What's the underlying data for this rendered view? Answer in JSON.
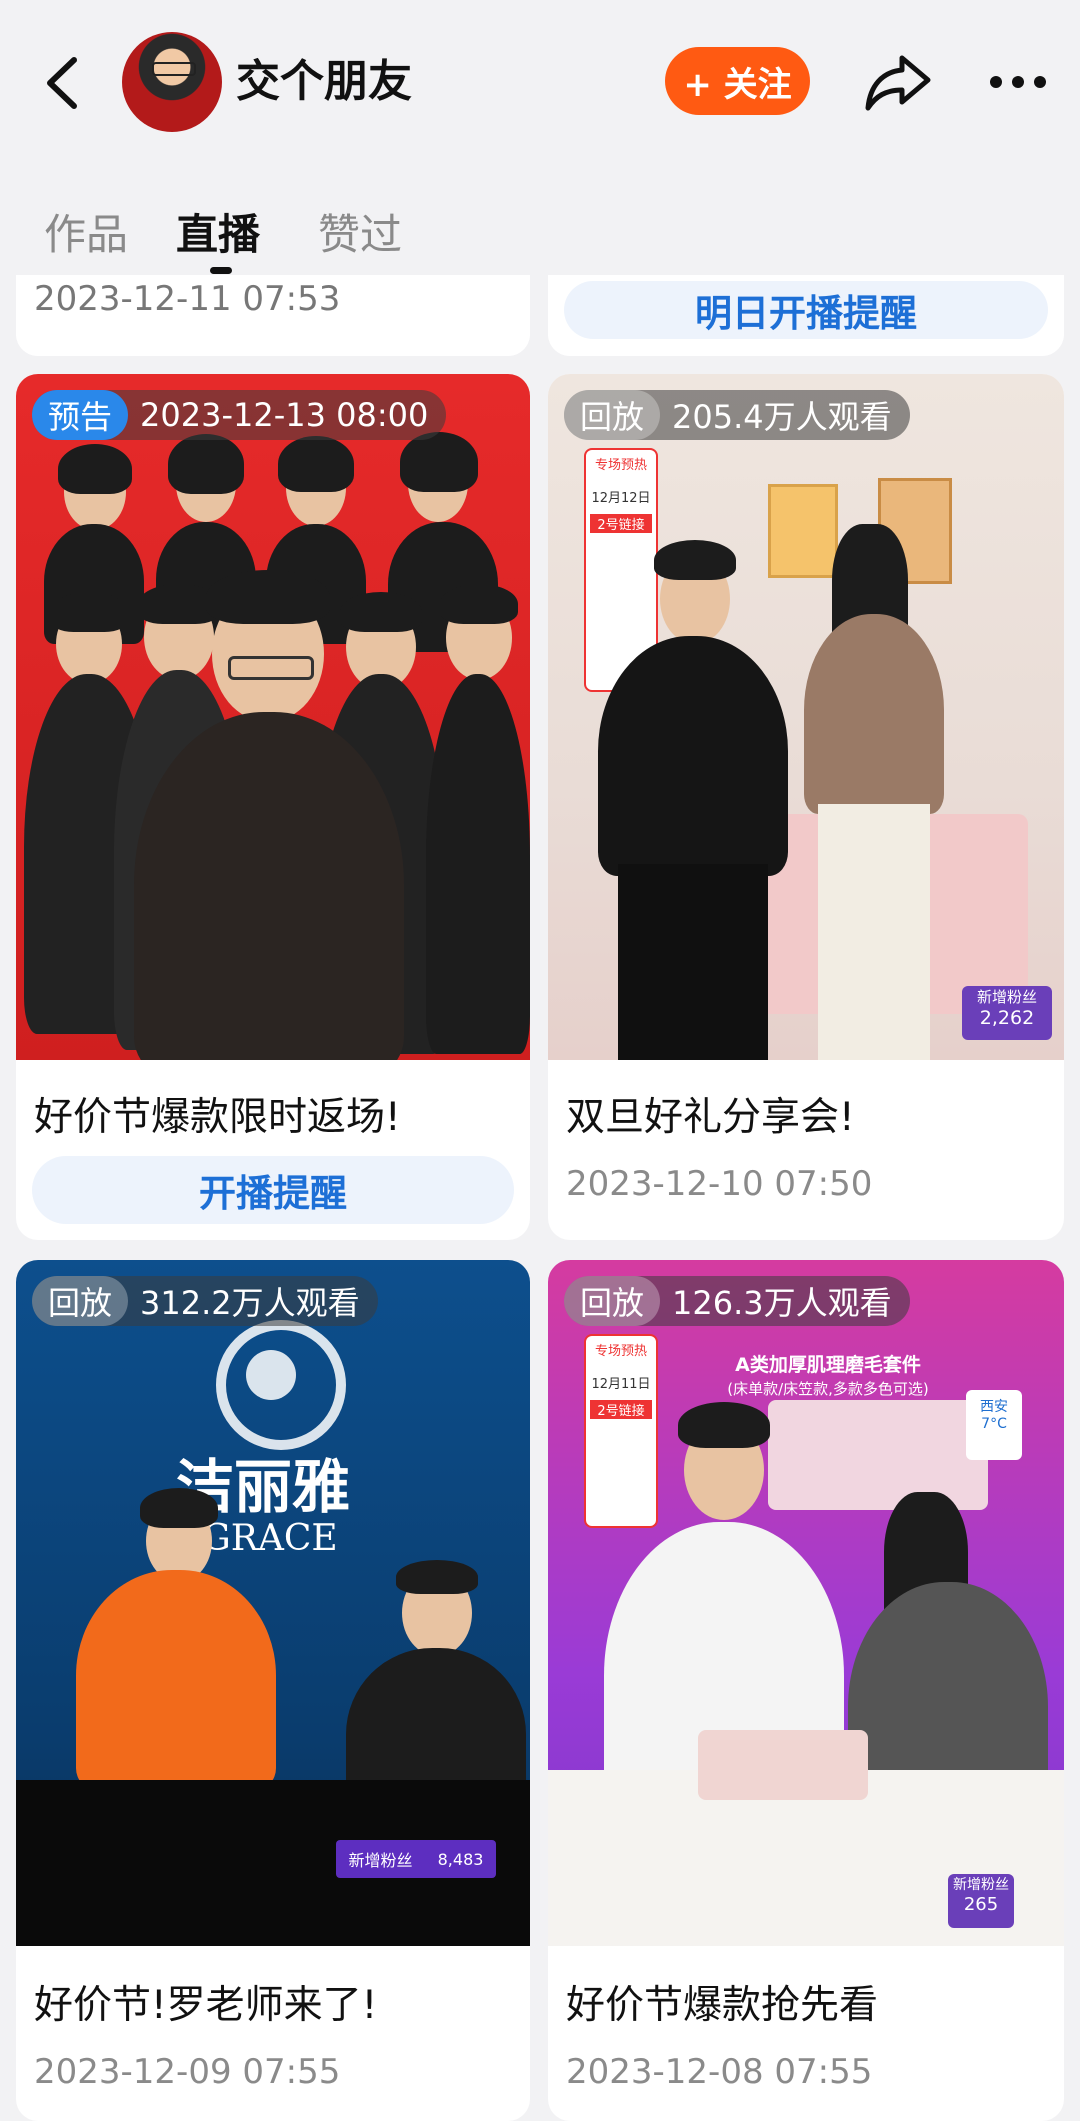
{
  "header": {
    "username": "交个朋友",
    "follow_label": "+ 关注"
  },
  "tabs": [
    {
      "label": "作品",
      "active": false
    },
    {
      "label": "直播",
      "active": true
    },
    {
      "label": "赞过",
      "active": false
    }
  ],
  "top_partial": {
    "left_date": "2023-12-11 07:53",
    "right_button": "明日开播提醒"
  },
  "cards": [
    {
      "badge": "预告",
      "badge_meta": "2023-12-13 08:00",
      "title": "好价节爆款限时返场!",
      "button": "开播提醒"
    },
    {
      "badge": "回放",
      "badge_meta": "205.4万人观看",
      "title": "双旦好礼分享会!",
      "date": "2023-12-10 07:50",
      "overlay": {
        "fans_label": "新增粉丝",
        "fans_count": "2,262",
        "promo_date": "12月12日",
        "promo_tag": "2号链接",
        "promo_head": "专场预热"
      }
    },
    {
      "badge": "回放",
      "badge_meta": "312.2万人观看",
      "title": "好价节!罗老师来了!",
      "date": "2023-12-09 07:55",
      "overlay": {
        "brand_cn": "洁丽雅",
        "brand_en": "GRACE",
        "fans_label": "新增粉丝",
        "fans_count": "8,483"
      }
    },
    {
      "badge": "回放",
      "badge_meta": "126.3万人观看",
      "title": "好价节爆款抢先看",
      "date": "2023-12-08 07:55",
      "overlay": {
        "banner": "A类加厚肌理磨毛套件",
        "sub_banner": "(床单款/床笠款,多款多色可选)",
        "fans_label": "新增粉丝",
        "fans_count": "265",
        "weather_city": "西安",
        "weather_temp": "7°C",
        "promo_date": "12月11日",
        "promo_tag": "2号链接",
        "promo_head": "专场预热"
      }
    }
  ],
  "colors": {
    "accent_orange": "#ff5a12",
    "remind_blue": "#1d6fd6",
    "notice_badge": "#2a88ea"
  }
}
